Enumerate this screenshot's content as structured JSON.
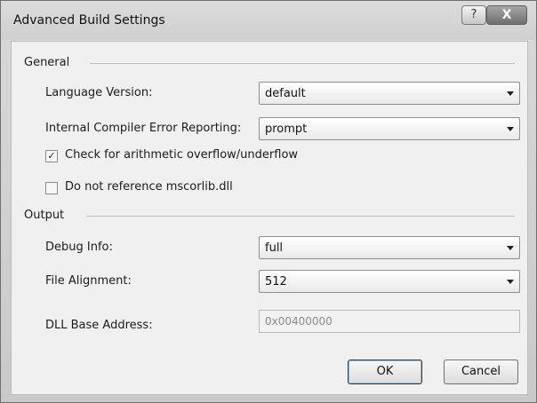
{
  "window": {
    "title": "Advanced Build Settings",
    "help_glyph": "?",
    "close_glyph": "X"
  },
  "general": {
    "group_title": "General",
    "language_version": {
      "label": "Language Version:",
      "value": "default"
    },
    "compiler_error_reporting": {
      "label": "Internal Compiler Error Reporting:",
      "value": "prompt"
    },
    "check_overflow": {
      "label": "Check for arithmetic overflow/underflow",
      "checked": true,
      "mark": "✓"
    },
    "no_mscorlib": {
      "label": "Do not reference mscorlib.dll",
      "checked": false,
      "mark": ""
    }
  },
  "output": {
    "group_title": "Output",
    "debug_info": {
      "label": "Debug Info:",
      "value": "full"
    },
    "file_alignment": {
      "label": "File Alignment:",
      "value": "512"
    },
    "dll_base_address": {
      "label": "DLL Base Address:",
      "value": "0x00400000"
    }
  },
  "buttons": {
    "ok": "OK",
    "cancel": "Cancel"
  }
}
